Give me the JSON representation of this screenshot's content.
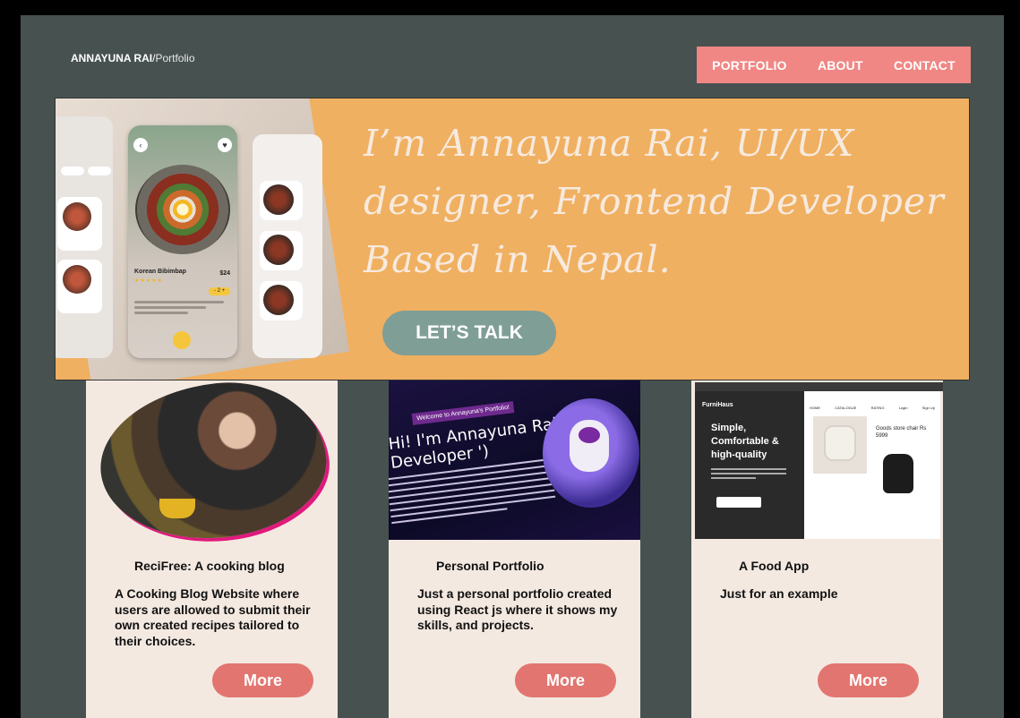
{
  "header": {
    "brand_name": "ANNAYUNA RAI",
    "brand_slash": "/",
    "brand_suffix": "Portfolio",
    "nav": [
      "PORTFOLIO",
      "ABOUT",
      "CONTACT"
    ]
  },
  "hero": {
    "headline_line1": "I’m Annayuna Rai,  UI/UX",
    "headline_line2": "designer, Frontend Developer",
    "headline_line3": "Based in Nepal.",
    "cta_label": "LET’S TALK",
    "mockup": {
      "dish_name": "Korean Bibimbap",
      "price": "$24"
    }
  },
  "projects": [
    {
      "title": "ReciFree: A cooking blog",
      "description": "A Cooking Blog Website where users are allowed to submit their own created recipes tailored to their choices.",
      "button": "More"
    },
    {
      "title": "Personal Portfolio",
      "description": "Just a personal portfolio created using React js where it shows my skills, and projects.",
      "button": "More",
      "preview_badge": "Welcome to Annayuna's Portfolio!",
      "preview_heading": "Hi! I'm Annayuna Rai ('Web Developer ')"
    },
    {
      "title": "A Food App",
      "description": "Just for an example",
      "button": "More",
      "preview": {
        "brand": "FurniHaus",
        "heading": "Simple, Comfortable & high-quality",
        "nav": [
          "HOME",
          "CATALOGUE",
          "RATING",
          "Login",
          "Sign Up"
        ],
        "product": "Goods store chair Rs 5999"
      }
    }
  ],
  "colors": {
    "background": "#475250",
    "nav": "#f08784",
    "hero": "#f0b061",
    "cta": "#7f9e96",
    "card": "#f4e9e1",
    "more_button": "#e27570"
  }
}
